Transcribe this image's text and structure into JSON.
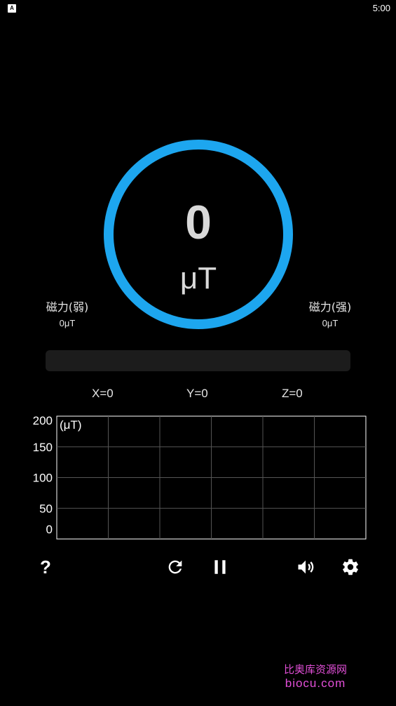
{
  "status_bar": {
    "app_icon_letter": "A",
    "time": "5:00"
  },
  "gauge": {
    "value": "0",
    "unit": "μT",
    "ring_color": "#1da6ef"
  },
  "weak_label": {
    "title": "磁力(弱)",
    "value": "0μT"
  },
  "strong_label": {
    "title": "磁力(强)",
    "value": "0μT"
  },
  "strength_bar": {
    "fraction": 0
  },
  "axes": {
    "x": "X=0",
    "y": "Y=0",
    "z": "Z=0"
  },
  "chart_data": {
    "type": "line",
    "unit_label": "(μT)",
    "y_ticks": [
      "200",
      "150",
      "100",
      "50",
      "0"
    ],
    "ylim": [
      0,
      200
    ],
    "grid": true,
    "series": [
      {
        "values": []
      }
    ]
  },
  "toolbar": {
    "help_label": "?",
    "icons": [
      "help-icon",
      "refresh-icon",
      "pause-icon",
      "volume-icon",
      "settings-icon"
    ]
  },
  "watermark": {
    "line1": "比奥库资源网",
    "line2": "biocu.com"
  }
}
